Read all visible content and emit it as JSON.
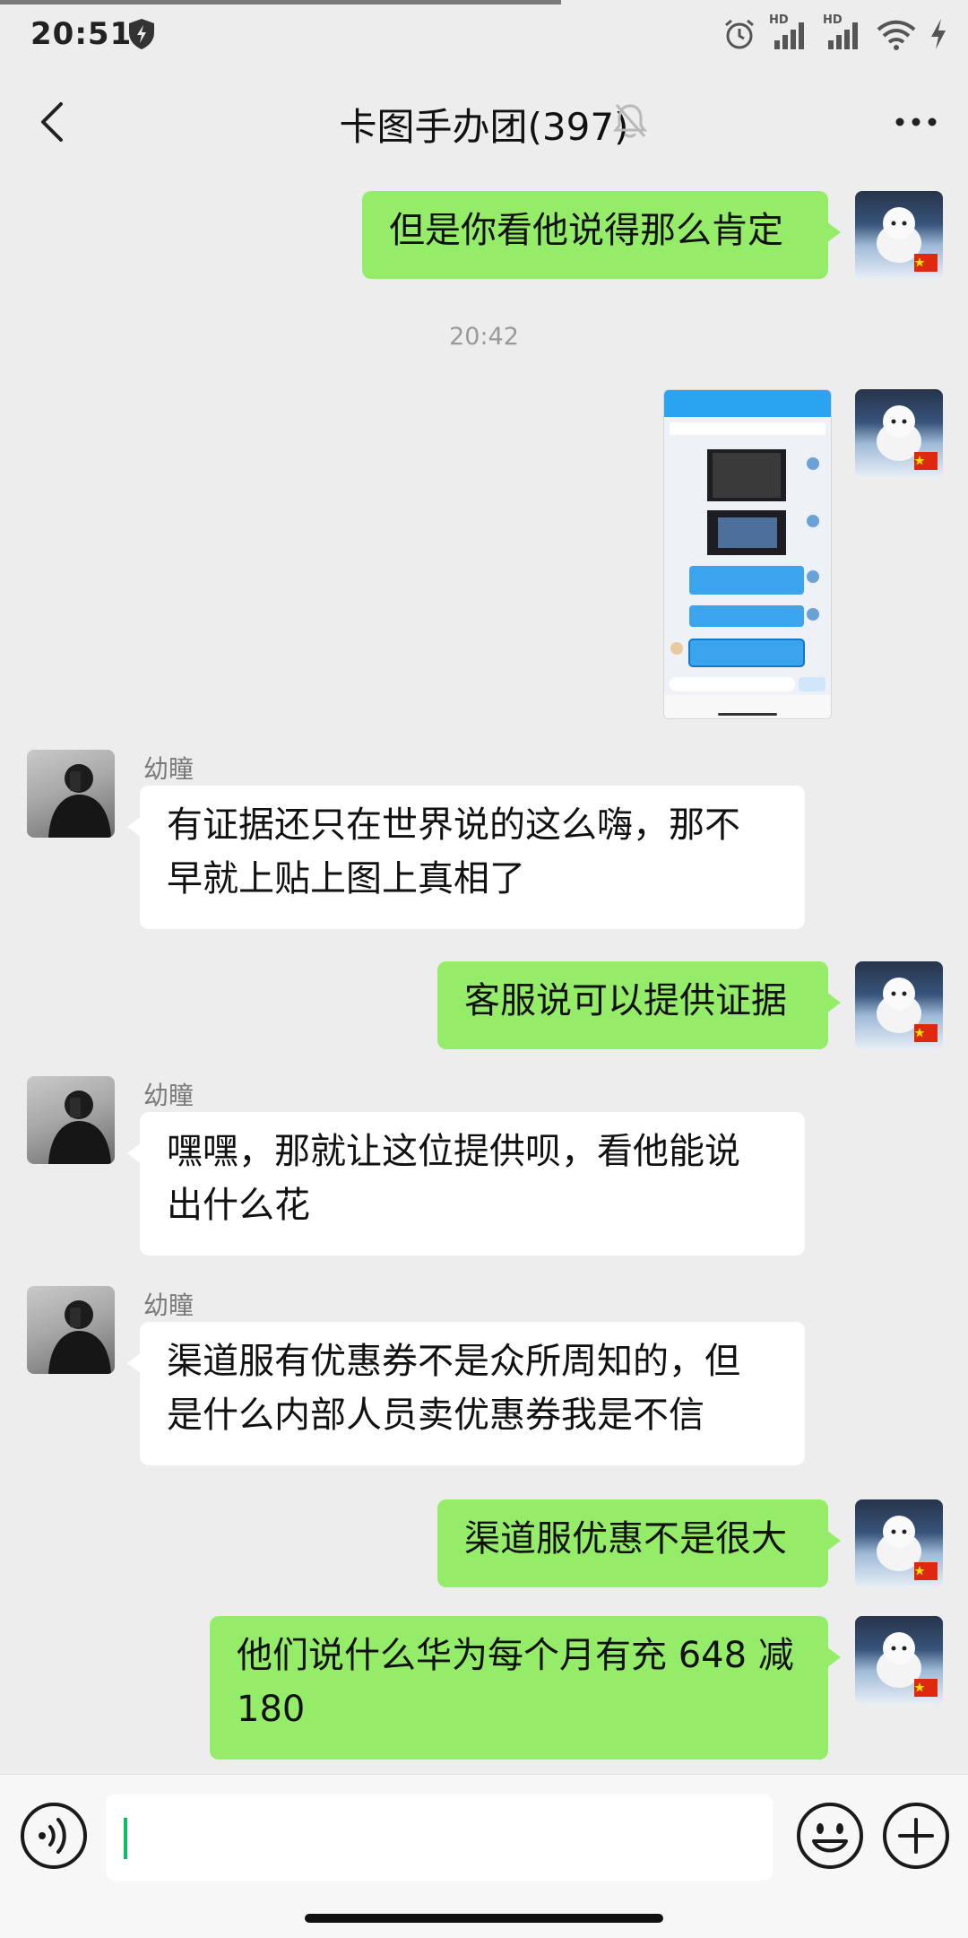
{
  "status_bar": {
    "time": "20:51",
    "network_left": "HD",
    "network_right": "HD"
  },
  "header": {
    "title": "卡图手办团(397)"
  },
  "messages": [
    {
      "side": "me",
      "text": "但是你看他说得那么肯定"
    },
    {
      "type": "timestamp",
      "text": "20:42"
    },
    {
      "side": "me",
      "type": "image"
    },
    {
      "side": "other",
      "sender": "幼瞳",
      "lines": [
        "有证据还只在世界说的这么嗨，那不",
        "早就上贴上图上真相了"
      ]
    },
    {
      "side": "me",
      "text": "客服说可以提供证据"
    },
    {
      "side": "other",
      "sender": "幼瞳",
      "lines": [
        "嘿嘿，那就让这位提供呗，看他能说",
        "出什么花"
      ]
    },
    {
      "side": "other",
      "sender": "幼瞳",
      "lines": [
        "渠道服有优惠券不是众所周知的，但",
        "是什么内部人员卖优惠券我是不信"
      ]
    },
    {
      "side": "me",
      "text": "渠道服优惠不是很大"
    },
    {
      "side": "me",
      "lines": [
        "他们说什么华为每个月有充 648 减",
        "180"
      ]
    }
  ],
  "icons": {
    "back": "chevron-left-icon",
    "mute": "bell-off-icon",
    "more": "more-dots-icon",
    "voice": "voice-icon",
    "emoji": "emoji-icon",
    "plus": "plus-icon"
  },
  "colors": {
    "my_bubble": "#95ec69",
    "other_bubble": "#ffffff",
    "background": "#ededed",
    "caret": "#07c160"
  }
}
